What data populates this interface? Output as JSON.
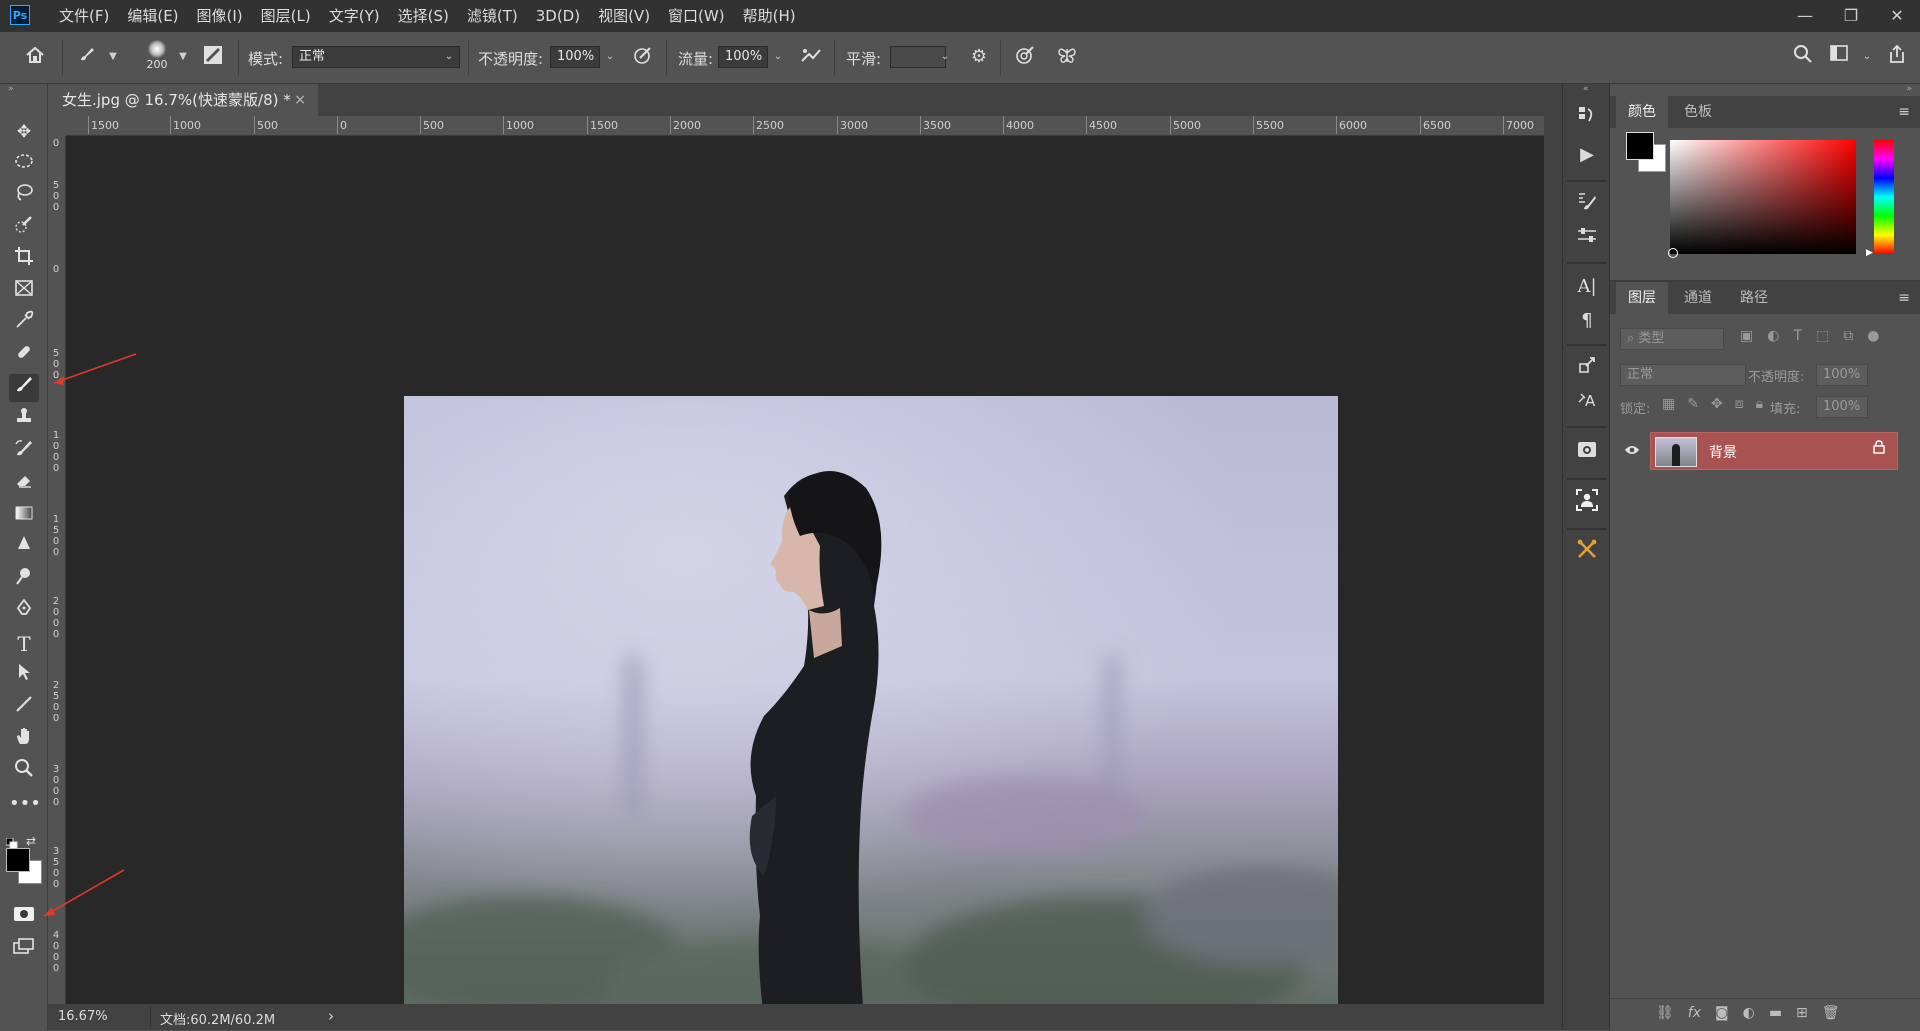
{
  "app": {
    "logo": "Ps",
    "menu": [
      "文件(F)",
      "编辑(E)",
      "图像(I)",
      "图层(L)",
      "文字(Y)",
      "选择(S)",
      "滤镜(T)",
      "3D(D)",
      "视图(V)",
      "窗口(W)",
      "帮助(H)"
    ],
    "window_controls": {
      "minimize": "—",
      "restore": "❐",
      "close": "✕"
    }
  },
  "options_bar": {
    "brush_size": "200",
    "mode_label": "模式:",
    "mode_value": "正常",
    "opacity_label": "不透明度:",
    "opacity_value": "100%",
    "flow_label": "流量:",
    "flow_value": "100%",
    "smoothing_label": "平滑:",
    "smoothing_value": ""
  },
  "document": {
    "tab_title": "女生.jpg @ 16.7%(快速蒙版/8) *",
    "close": "×",
    "zoom": "16.67%",
    "doc_info": "文档:60.2M/60.2M",
    "status_arrow": "›"
  },
  "rulers": {
    "top": [
      "1500",
      "1000",
      "500",
      "0",
      "500",
      "1000",
      "1500",
      "2000",
      "2500",
      "3000",
      "3500",
      "4000",
      "4500",
      "5000",
      "5500",
      "6000",
      "6500",
      "7000"
    ],
    "left": [
      "0",
      "500",
      "0",
      "500",
      "1000",
      "1500",
      "2000",
      "2500",
      "3000",
      "3500",
      "4000"
    ]
  },
  "panels": {
    "color_tabs": [
      "颜色",
      "色板"
    ],
    "layers_tabs": [
      "图层",
      "通道",
      "路径"
    ],
    "filter_kind": "类型",
    "blend_mode": "正常",
    "opacity_label": "不透明度:",
    "opacity_value": "100%",
    "lock_label": "锁定:",
    "fill_label": "填充:",
    "fill_value": "100%",
    "layer_name": "背景"
  },
  "colors": {
    "accent_layer": "#a85252",
    "foreground": "#000000",
    "background": "#ffffff",
    "annotation_arrow": "#e0392b"
  }
}
